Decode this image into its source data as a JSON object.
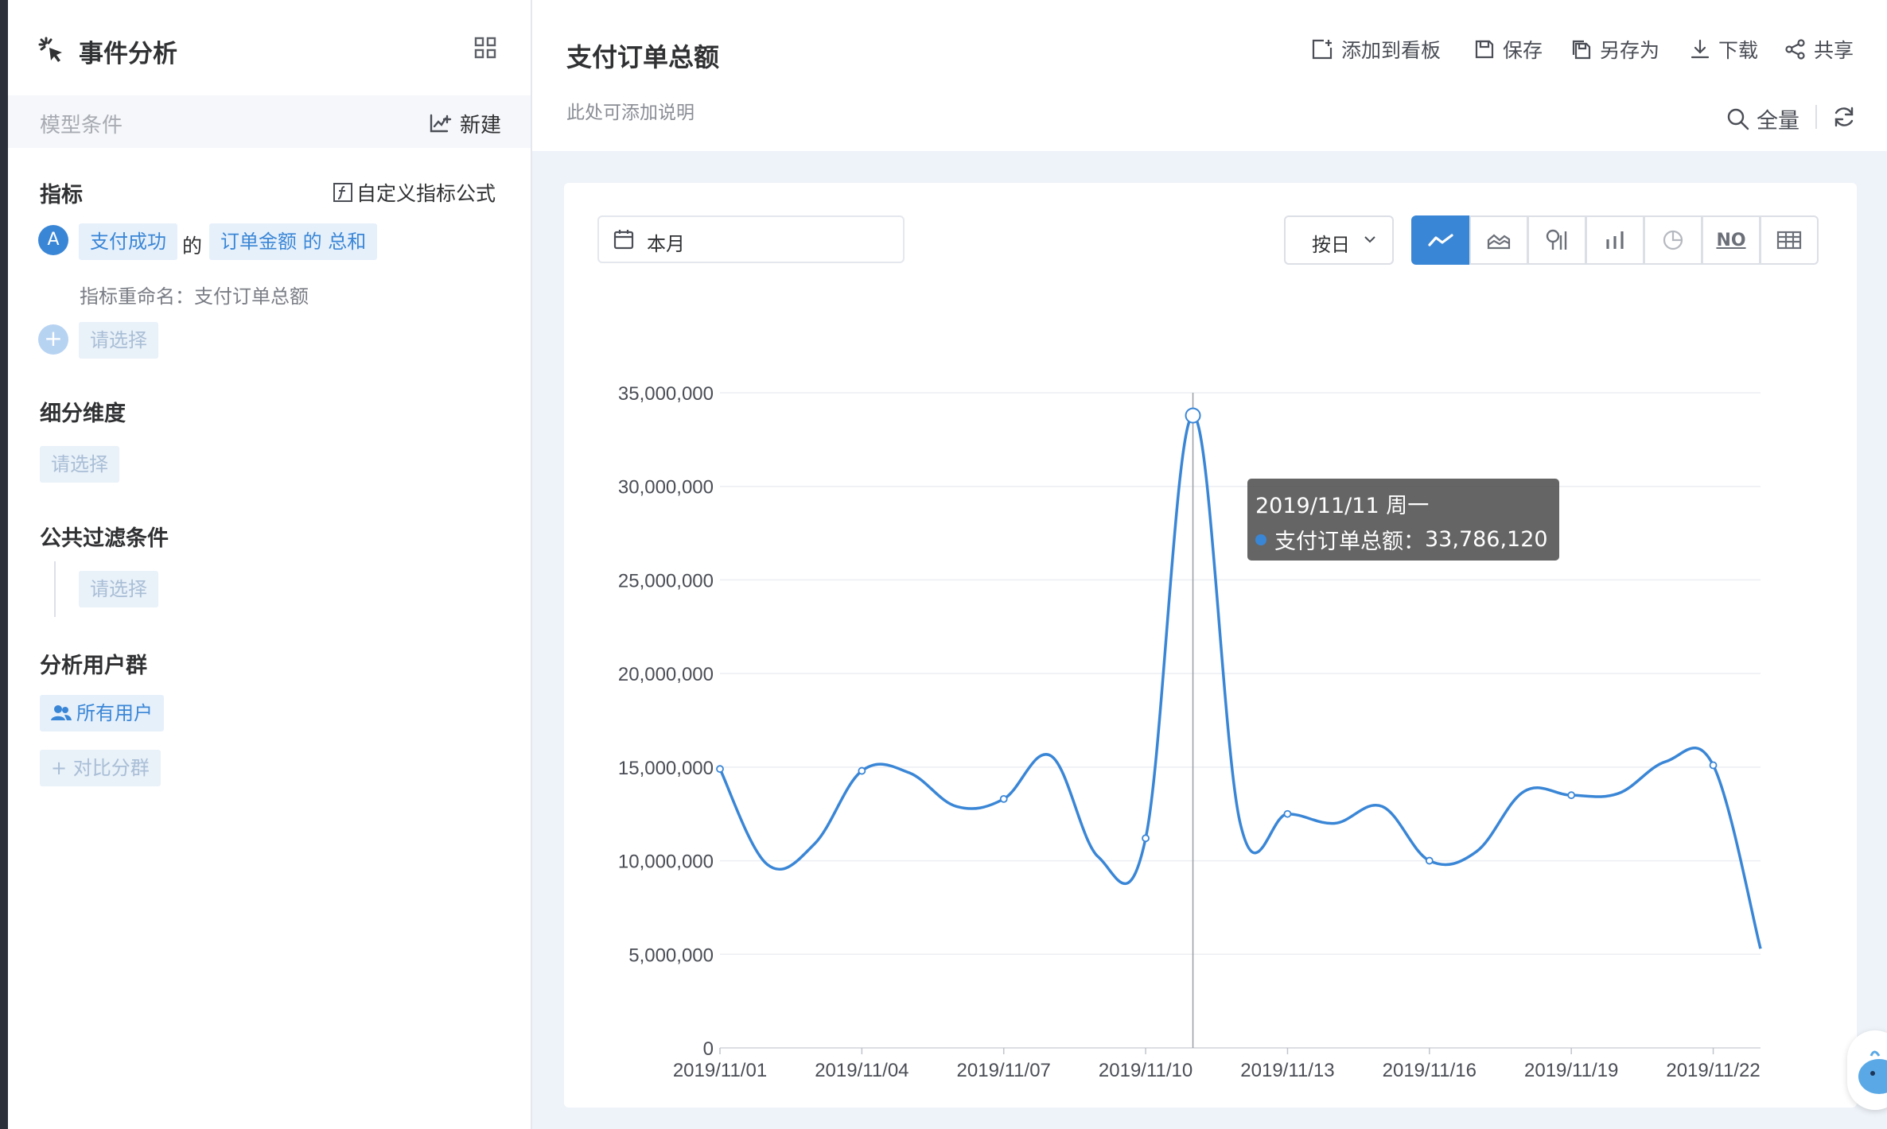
{
  "sidebar": {
    "app_title": "事件分析",
    "model_conditions_label": "模型条件",
    "new_label": "新建",
    "metrics": {
      "title": "指标",
      "custom_formula_label": "自定义指标公式",
      "item_badge": "A",
      "event_tag": "支付成功",
      "connector": "的",
      "property_tag": "订单金额 的 总和",
      "rename_text": "指标重命名：支付订单总额",
      "add_placeholder": "请选择"
    },
    "dimensions": {
      "title": "细分维度",
      "placeholder": "请选择"
    },
    "filters": {
      "title": "公共过滤条件",
      "placeholder": "请选择"
    },
    "user_groups": {
      "title": "分析用户群",
      "all_users": "所有用户",
      "compare_label": "+ 对比分群"
    }
  },
  "header": {
    "title": "支付订单总额",
    "description": "此处可添加说明",
    "actions": {
      "add_to_board": "添加到看板",
      "save": "保存",
      "save_as": "另存为",
      "download": "下载",
      "share": "共享"
    },
    "scope_label": "全量"
  },
  "controls": {
    "date_range": "本月",
    "granularity": "按日",
    "chart_type_icons": [
      "line-chart-icon",
      "area-chart-icon",
      "funnel-chart-icon",
      "bar-chart-icon",
      "pie-chart-icon",
      "number-icon",
      "table-icon"
    ],
    "number_icon_text": "NO"
  },
  "colors": {
    "accent": "#3a86d6",
    "line": "#3a86d6",
    "tag_bg": "#e6f0fb",
    "page_bg": "#eef3f9"
  },
  "tooltip": {
    "date": "2019/11/11 周一",
    "series_label": "支付订单总额：",
    "value": "33,786,120"
  },
  "chart_data": {
    "type": "line",
    "x": [
      "2019/11/01",
      "2019/11/02",
      "2019/11/03",
      "2019/11/04",
      "2019/11/05",
      "2019/11/06",
      "2019/11/07",
      "2019/11/08",
      "2019/11/09",
      "2019/11/10",
      "2019/11/11",
      "2019/11/12",
      "2019/11/13",
      "2019/11/14",
      "2019/11/15",
      "2019/11/16",
      "2019/11/17",
      "2019/11/18",
      "2019/11/19",
      "2019/11/20",
      "2019/11/21",
      "2019/11/22",
      "2019/11/23"
    ],
    "x_tick_labels": [
      "2019/11/01",
      "2019/11/04",
      "2019/11/07",
      "2019/11/10",
      "2019/11/13",
      "2019/11/16",
      "2019/11/19",
      "2019/11/22"
    ],
    "series": [
      {
        "name": "支付订单总额",
        "values": [
          14900000,
          9800000,
          10900000,
          14800000,
          14700000,
          12900000,
          13300000,
          15600000,
          10200000,
          11200000,
          33786120,
          12000000,
          12500000,
          12000000,
          12900000,
          10000000,
          10500000,
          13700000,
          13500000,
          13600000,
          15300000,
          15100000,
          5300000
        ]
      }
    ],
    "y_ticks": [
      "0",
      "5,000,000",
      "10,000,000",
      "15,000,000",
      "20,000,000",
      "25,000,000",
      "30,000,000",
      "35,000,000"
    ],
    "ylim": [
      0,
      35000000
    ],
    "grid": true,
    "highlight_index": 10
  }
}
